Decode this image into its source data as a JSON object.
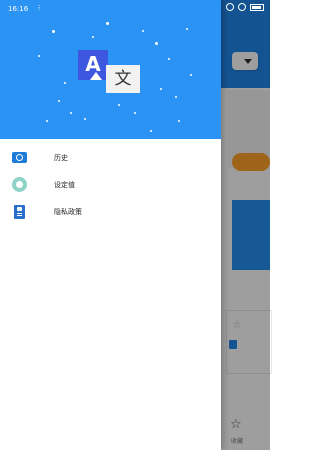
{
  "status_bar": {
    "time": "16:16",
    "network": "⁝"
  },
  "drawer": {
    "logo": {
      "latin_letter": "A",
      "chinese_char": "文"
    },
    "menu": [
      {
        "label": "历史",
        "icon": "history-icon"
      },
      {
        "label": "设定值",
        "icon": "settings-icon"
      },
      {
        "label": "隐私政策",
        "icon": "privacy-policy-icon"
      }
    ]
  },
  "background": {
    "bottom_nav_label": "收藏"
  },
  "colors": {
    "primary_blue": "#2a93f3",
    "accent_orange": "#ffa32a",
    "logo_blue": "#3d57e0",
    "settings_teal": "#8ed3c7"
  }
}
